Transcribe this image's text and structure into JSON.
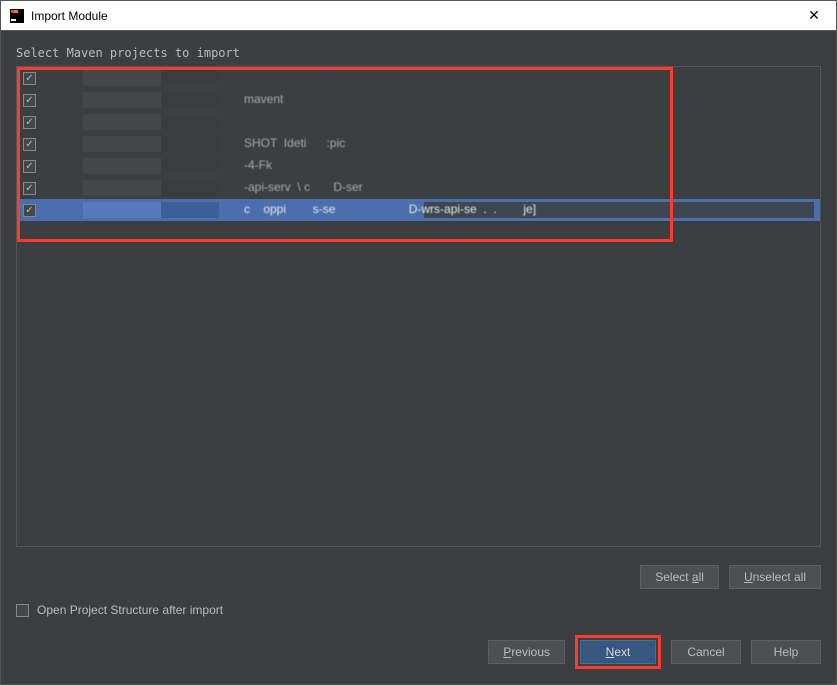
{
  "window": {
    "title": "Import Module"
  },
  "instruction": "Select Maven projects to import",
  "projects": [
    {
      "checked": true,
      "selected": false,
      "text": ""
    },
    {
      "checked": true,
      "selected": false,
      "text": "mavent"
    },
    {
      "checked": true,
      "selected": false,
      "text": ""
    },
    {
      "checked": true,
      "selected": false,
      "text": "SHOT  Ideti      :pic"
    },
    {
      "checked": true,
      "selected": false,
      "text": "-4-Fk"
    },
    {
      "checked": true,
      "selected": false,
      "text": "-api-serv  \\ c       D-ser"
    },
    {
      "checked": true,
      "selected": true,
      "text": "c    oppi        s-se                      D-wrs-api-se  .  .        je]"
    }
  ],
  "buttons": {
    "select_all": "Select all",
    "unselect_all": "Unselect all",
    "previous": "Previous",
    "next": "Next",
    "cancel": "Cancel",
    "help": "Help"
  },
  "option": {
    "open_project_structure_label": "Open Project Structure after import",
    "open_project_structure_checked": false
  }
}
